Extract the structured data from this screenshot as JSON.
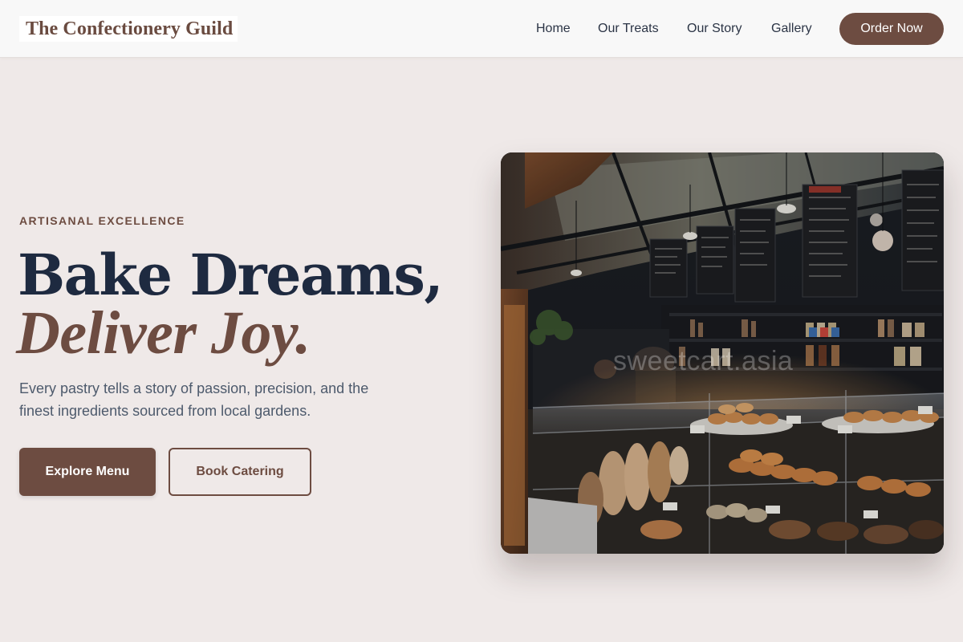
{
  "header": {
    "brand": "The Confectionery Guild",
    "nav": [
      {
        "label": "Home"
      },
      {
        "label": "Our Treats"
      },
      {
        "label": "Our Story"
      },
      {
        "label": "Gallery"
      }
    ],
    "cta_label": "Order Now"
  },
  "hero": {
    "eyebrow": "ARTISANAL EXCELLENCE",
    "headline_line1": "Bake Dreams,",
    "headline_line2": "Deliver Joy.",
    "description": "Every pastry tells a story of passion, precision, and the finest ingredients sourced from local gardens.",
    "primary_button": "Explore Menu",
    "secondary_button": "Book Catering",
    "image": {
      "subject": "bakery-counter-photo",
      "watermark": "sweetcart.asia"
    }
  },
  "colors": {
    "brand_brown": "#6d4c41",
    "headline_navy": "#1e2a40",
    "page_background": "#efe9e8",
    "header_background": "#f8f8f8",
    "body_text": "#4d5a6c"
  }
}
